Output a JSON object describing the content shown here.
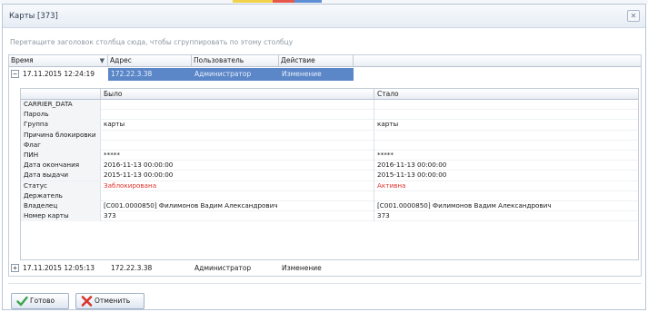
{
  "window": {
    "title": "Карты [373]",
    "close_glyph": "✕"
  },
  "group_hint": "Перетащите заголовок столбца сюда, чтобы сгруппировать по этому столбцу",
  "grid": {
    "columns": [
      "Время",
      "Адрес",
      "Пользователь",
      "Действие"
    ],
    "rows": [
      {
        "expander": "−",
        "time": "17.11.2015 12:24:19",
        "address": "172.22.3.38",
        "user": "Администратор",
        "action": "Изменение",
        "selected": true
      },
      {
        "expander": "+",
        "time": "17.11.2015 12:05:13",
        "address": "172.22.3.38",
        "user": "Администратор",
        "action": "Изменение",
        "selected": false
      }
    ]
  },
  "detail": {
    "columns": [
      "",
      "Было",
      "Стало"
    ],
    "rows": [
      {
        "name": "CARRIER_DATA",
        "old": "",
        "new": ""
      },
      {
        "name": "Пароль",
        "old": "",
        "new": ""
      },
      {
        "name": "Группа",
        "old": "карты",
        "new": "карты"
      },
      {
        "name": "Причина блокировки",
        "old": "",
        "new": ""
      },
      {
        "name": "Флаг",
        "old": "",
        "new": ""
      },
      {
        "name": "ПИН",
        "old": "*****",
        "new": "*****"
      },
      {
        "name": "Дата окончания",
        "old": "2016-11-13 00:00:00",
        "new": "2016-11-13 00:00:00"
      },
      {
        "name": "Дата выдачи",
        "old": "2015-11-13 00:00:00",
        "new": "2015-11-13 00:00:00"
      },
      {
        "name": "Статус",
        "old": "Заблокирована",
        "new": "Активна",
        "highlight": true
      },
      {
        "name": "Держатель",
        "old": "",
        "new": ""
      },
      {
        "name": "Владелец",
        "old": "[C001.0000850] Филимонов Вадим Александрович",
        "new": "[C001.0000850] Филимонов Вадим Александрович"
      },
      {
        "name": "Номер карты",
        "old": "373",
        "new": "373"
      }
    ]
  },
  "buttons": {
    "ok_label": "Готово",
    "cancel_label": "Отменить"
  },
  "colors": {
    "selected_row": "#5b86c7",
    "changed_value": "#e0312b",
    "ok_icon": "#3fa34d",
    "cancel_icon": "#d9342b"
  },
  "icons": {
    "ok": "check-icon",
    "cancel": "cross-icon",
    "sort": "sort-down-icon"
  }
}
